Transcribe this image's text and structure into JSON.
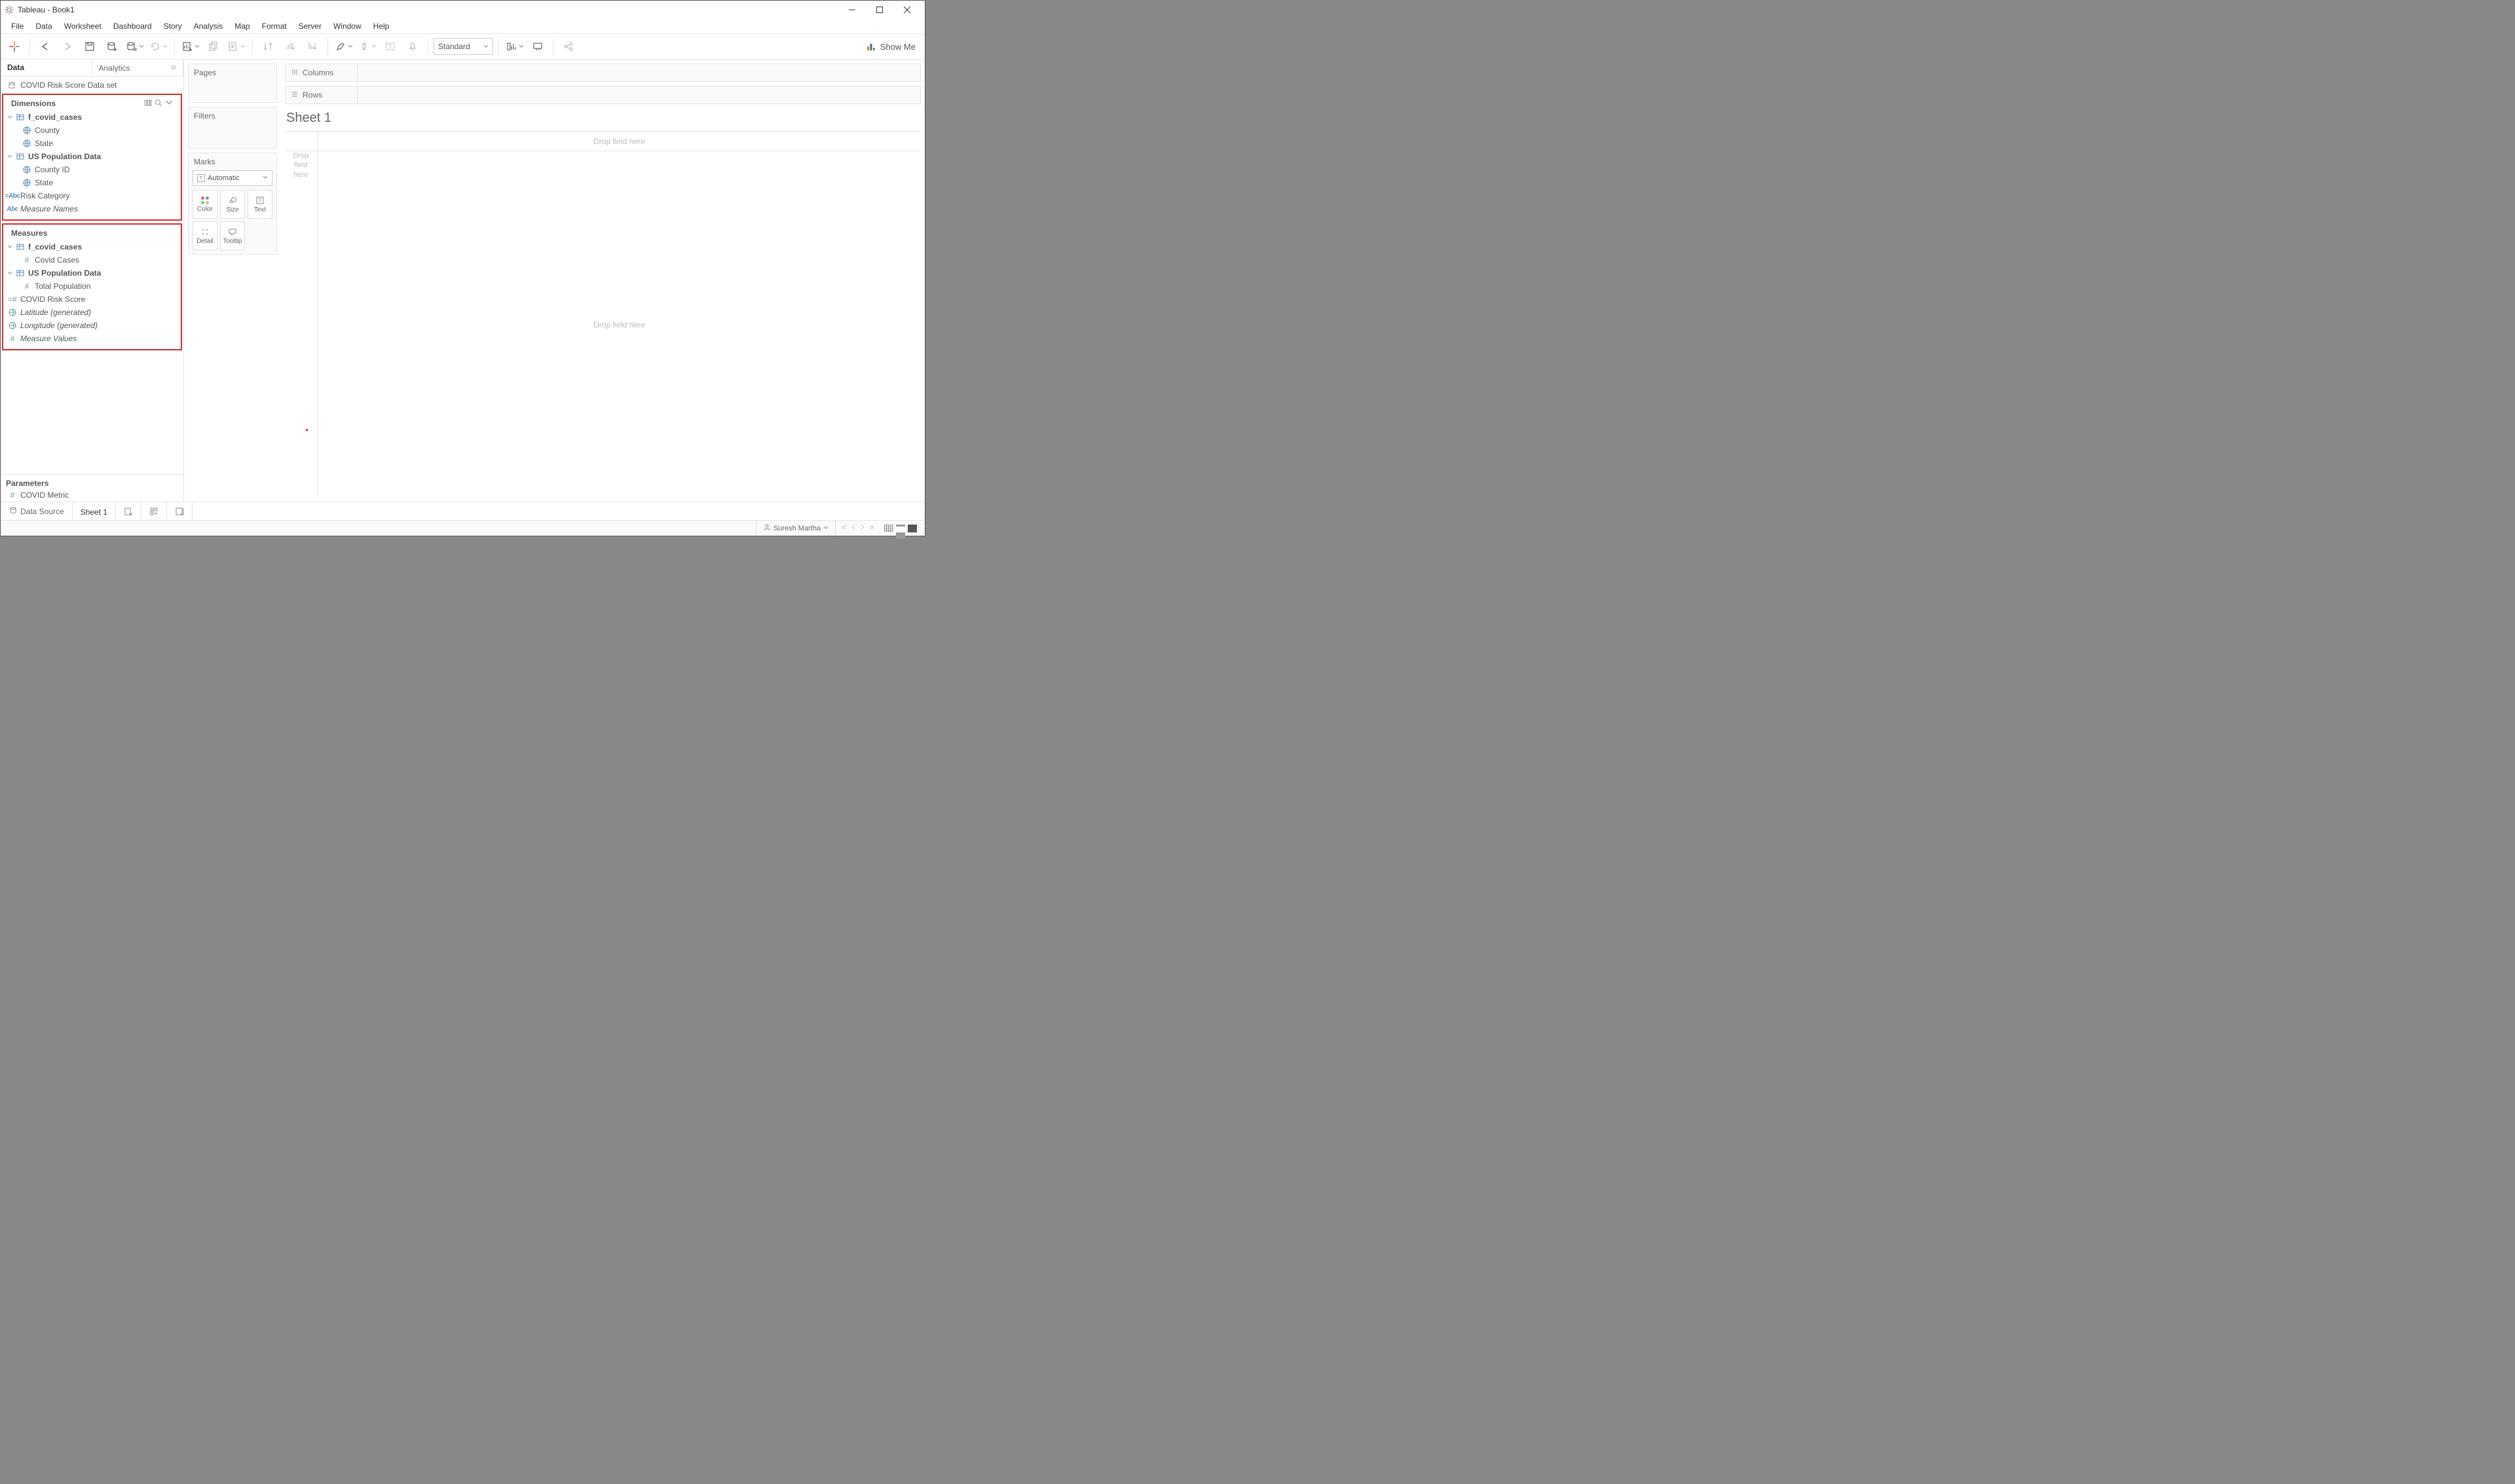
{
  "window": {
    "title": "Tableau - Book1"
  },
  "menu": [
    "File",
    "Data",
    "Worksheet",
    "Dashboard",
    "Story",
    "Analysis",
    "Map",
    "Format",
    "Server",
    "Window",
    "Help"
  ],
  "toolbar": {
    "fit_mode": "Standard",
    "show_me": "Show Me"
  },
  "sidebar": {
    "tabs": {
      "data": "Data",
      "analytics": "Analytics"
    },
    "datasource": "COVID Risk Score Data set",
    "dimensions_label": "Dimensions",
    "dimensions": {
      "tbl1": "f_covid_cases",
      "tbl1_items": [
        "County",
        "State"
      ],
      "tbl2": "US Population Data",
      "tbl2_items": [
        "County ID",
        "State"
      ],
      "risk": "Risk Category",
      "mnames": "Measure Names"
    },
    "measures_label": "Measures",
    "measures": {
      "tbl1": "f_covid_cases",
      "tbl1_items": [
        "Covid Cases"
      ],
      "tbl2": "US Population Data",
      "tbl2_items": [
        "Total Population"
      ],
      "score": "COVID Risk Score",
      "lat": "Latitude (generated)",
      "lon": "Longitude (generated)",
      "mvals": "Measure Values"
    },
    "parameters_label": "Parameters",
    "parameters": {
      "metric": "COVID Metric"
    }
  },
  "cards": {
    "pages": "Pages",
    "filters": "Filters",
    "marks": "Marks",
    "marks_mode": "Automatic",
    "color": "Color",
    "size": "Size",
    "text": "Text",
    "detail": "Detail",
    "tooltip": "Tooltip"
  },
  "shelves": {
    "columns": "Columns",
    "rows": "Rows"
  },
  "sheet": {
    "title": "Sheet 1",
    "drop_here": "Drop field here",
    "drop_left": "Drop\nfield\nhere"
  },
  "bottom": {
    "datasource": "Data Source",
    "sheet": "Sheet 1"
  },
  "status": {
    "user": "Suresh Martha"
  }
}
